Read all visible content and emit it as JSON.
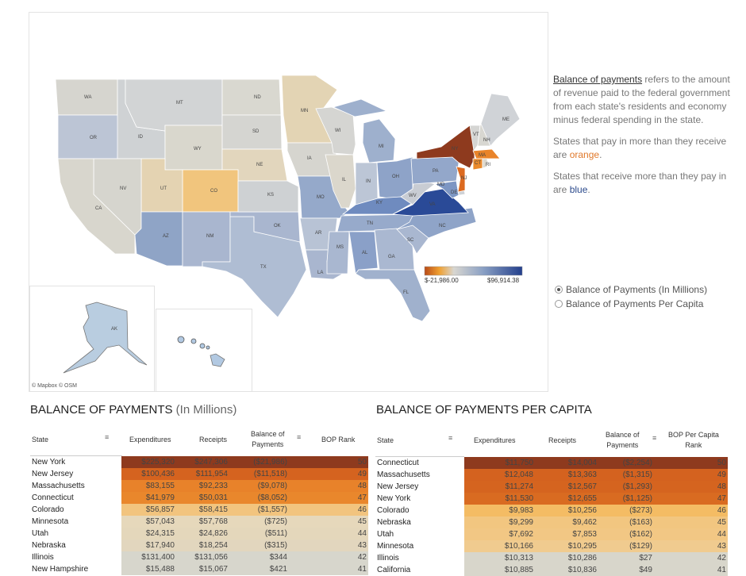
{
  "map": {
    "attribution": "© Mapbox © OSM",
    "legend": {
      "min_label": "$-21,986.00",
      "max_label": "$96,914.38",
      "colors": [
        "#b84a18",
        "#f0a030",
        "#d8d6d0",
        "#8aa0c4",
        "#233f8c"
      ]
    },
    "states": [
      {
        "abbr": "WA",
        "color": "#d6d5cf"
      },
      {
        "abbr": "OR",
        "color": "#bcc5d5"
      },
      {
        "abbr": "ID",
        "color": "#cfd2d4"
      },
      {
        "abbr": "MT",
        "color": "#d2d4d5"
      },
      {
        "abbr": "WY",
        "color": "#d9d7cd"
      },
      {
        "abbr": "ND",
        "color": "#d9d8d0"
      },
      {
        "abbr": "SD",
        "color": "#d5d5d1"
      },
      {
        "abbr": "NE",
        "color": "#e2d6bd"
      },
      {
        "abbr": "CO",
        "color": "#f1c57d"
      },
      {
        "abbr": "UT",
        "color": "#e4d3b2"
      },
      {
        "abbr": "NV",
        "color": "#d6d5ce"
      },
      {
        "abbr": "CA",
        "color": "#d8d6cd"
      },
      {
        "abbr": "AZ",
        "color": "#8fa4c6"
      },
      {
        "abbr": "NM",
        "color": "#a9b6cf"
      },
      {
        "abbr": "TX",
        "color": "#afbdd3"
      },
      {
        "abbr": "OK",
        "color": "#a9b6cf"
      },
      {
        "abbr": "KS",
        "color": "#ced1d3"
      },
      {
        "abbr": "MN",
        "color": "#e3d4b4"
      },
      {
        "abbr": "IA",
        "color": "#d6d5cf"
      },
      {
        "abbr": "MO",
        "color": "#95a9ca"
      },
      {
        "abbr": "AR",
        "color": "#b8c3d5"
      },
      {
        "abbr": "LA",
        "color": "#a9b6cf"
      },
      {
        "abbr": "WI",
        "color": "#d5d5d2"
      },
      {
        "abbr": "IL",
        "color": "#dbd7cc"
      },
      {
        "abbr": "MI",
        "color": "#9eb0cd"
      },
      {
        "abbr": "IN",
        "color": "#bcc6d6"
      },
      {
        "abbr": "OH",
        "color": "#8ea3c8"
      },
      {
        "abbr": "KY",
        "color": "#6f8bbf"
      },
      {
        "abbr": "TN",
        "color": "#97aacb"
      },
      {
        "abbr": "MS",
        "color": "#a9b7d0"
      },
      {
        "abbr": "AL",
        "color": "#8aa0c8"
      },
      {
        "abbr": "GA",
        "color": "#aab8d1"
      },
      {
        "abbr": "FL",
        "color": "#a0b1cd"
      },
      {
        "abbr": "SC",
        "color": "#a9b7d0"
      },
      {
        "abbr": "NC",
        "color": "#8fa4c8"
      },
      {
        "abbr": "VA",
        "color": "#2a4a97"
      },
      {
        "abbr": "WV",
        "color": "#c8ccd3"
      },
      {
        "abbr": "PA",
        "color": "#93a7ca"
      },
      {
        "abbr": "MD",
        "color": "#7d96c3"
      },
      {
        "abbr": "DE",
        "color": "#cfd2d6"
      },
      {
        "abbr": "NJ",
        "color": "#dc6a20"
      },
      {
        "abbr": "NY",
        "color": "#8e3a1e"
      },
      {
        "abbr": "VT",
        "color": "#d5d5d3"
      },
      {
        "abbr": "NH",
        "color": "#d8d7d1"
      },
      {
        "abbr": "ME",
        "color": "#d0d3d7"
      },
      {
        "abbr": "MA",
        "color": "#e9842a"
      },
      {
        "abbr": "CT",
        "color": "#ea8a2c"
      },
      {
        "abbr": "RI",
        "color": "#dcd7cc"
      },
      {
        "abbr": "AK",
        "color": "#b9cde0"
      },
      {
        "abbr": "HI",
        "color": "#b2c9e2"
      }
    ]
  },
  "info": {
    "term": "Balance of payments",
    "definition": " refers to the amount of revenue paid to the federal government from each state's residents and economy minus federal spending in the state.",
    "orange_pre": "States that pay in more than they receive are ",
    "orange_word": "orange",
    "blue_pre": "States that receive more than they pay in are ",
    "blue_word": "blue",
    "period": "."
  },
  "radio": {
    "options": [
      {
        "label": "Balance of Payments (In Millions)",
        "selected": true
      },
      {
        "label": "Balance of Payments Per Capita",
        "selected": false
      }
    ]
  },
  "table_millions": {
    "title": "BALANCE OF PAYMENTS",
    "subtitle": "(In Millions)",
    "headers": {
      "state": "State",
      "exp": "Expenditures",
      "rec": "Receipts",
      "bop1": "Balance of",
      "bop2": "Payments",
      "rank": "BOP Rank"
    },
    "rows": [
      {
        "state": "New York",
        "exp": "$225,320",
        "rec": "$247,306",
        "bop": "($21,986)",
        "rank": "50",
        "color": "#8e3a1e"
      },
      {
        "state": "New Jersey",
        "exp": "$100,436",
        "rec": "$111,954",
        "bop": "($11,518)",
        "rank": "49",
        "color": "#d5631f"
      },
      {
        "state": "Massachusetts",
        "exp": "$83,155",
        "rec": "$92,233",
        "bop": "($9,078)",
        "rank": "48",
        "color": "#e8822a"
      },
      {
        "state": "Connecticut",
        "exp": "$41,979",
        "rec": "$50,031",
        "bop": "($8,052)",
        "rank": "47",
        "color": "#e9872c"
      },
      {
        "state": "Colorado",
        "exp": "$56,857",
        "rec": "$58,415",
        "bop": "($1,557)",
        "rank": "46",
        "color": "#f2c47e"
      },
      {
        "state": "Minnesota",
        "exp": "$57,043",
        "rec": "$57,768",
        "bop": "($725)",
        "rank": "45",
        "color": "#e6d8bb"
      },
      {
        "state": "Utah",
        "exp": "$24,315",
        "rec": "$24,826",
        "bop": "($511)",
        "rank": "44",
        "color": "#e4d7bb"
      },
      {
        "state": "Nebraska",
        "exp": "$17,940",
        "rec": "$18,254",
        "bop": "($315)",
        "rank": "43",
        "color": "#e2d6be"
      },
      {
        "state": "Illinois",
        "exp": "$131,400",
        "rec": "$131,056",
        "bop": "$344",
        "rank": "42",
        "color": "#d7d6cc"
      },
      {
        "state": "New Hampshire",
        "exp": "$15,488",
        "rec": "$15,067",
        "bop": "$421",
        "rank": "41",
        "color": "#d7d6cc"
      }
    ]
  },
  "table_percapita": {
    "title": "BALANCE OF PAYMENTS PER CAPITA",
    "headers": {
      "state": "State",
      "exp": "Expenditures",
      "rec": "Receipts",
      "bop1": "Balance of",
      "bop2": "Payments",
      "rank1": "BOP Per Capita",
      "rank2": "Rank"
    },
    "rows": [
      {
        "state": "Connecticut",
        "exp": "$11,750",
        "rec": "$14,004",
        "bop": "($2,254)",
        "rank": "50",
        "color": "#8e3a1e"
      },
      {
        "state": "Massachusetts",
        "exp": "$12,048",
        "rec": "$13,363",
        "bop": "($1,315)",
        "rank": "49",
        "color": "#d4621f"
      },
      {
        "state": "New Jersey",
        "exp": "$11,274",
        "rec": "$12,567",
        "bop": "($1,293)",
        "rank": "48",
        "color": "#d5641f"
      },
      {
        "state": "New York",
        "exp": "$11,530",
        "rec": "$12,655",
        "bop": "($1,125)",
        "rank": "47",
        "color": "#d96b21"
      },
      {
        "state": "Colorado",
        "exp": "$9,983",
        "rec": "$10,256",
        "bop": "($273)",
        "rank": "46",
        "color": "#f4bc64"
      },
      {
        "state": "Nebraska",
        "exp": "$9,299",
        "rec": "$9,462",
        "bop": "($163)",
        "rank": "45",
        "color": "#f2c680"
      },
      {
        "state": "Utah",
        "exp": "$7,692",
        "rec": "$7,853",
        "bop": "($162)",
        "rank": "44",
        "color": "#f2c784"
      },
      {
        "state": "Minnesota",
        "exp": "$10,166",
        "rec": "$10,295",
        "bop": "($129)",
        "rank": "43",
        "color": "#f0cb8f"
      },
      {
        "state": "Illinois",
        "exp": "$10,313",
        "rec": "$10,286",
        "bop": "$27",
        "rank": "42",
        "color": "#d8d6cb"
      },
      {
        "state": "California",
        "exp": "$10,885",
        "rec": "$10,836",
        "bop": "$49",
        "rank": "41",
        "color": "#d8d6cb"
      }
    ]
  }
}
